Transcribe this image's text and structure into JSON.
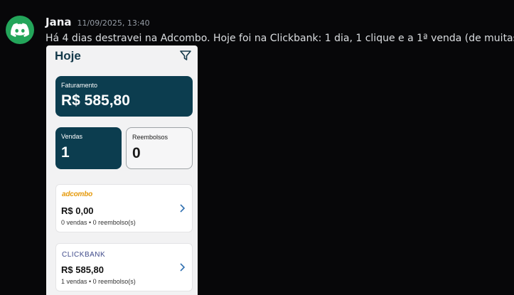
{
  "message": {
    "author": "Jana",
    "timestamp": "11/09/2025, 13:40",
    "text": "Há 4 dias destravei na Adcombo. Hoje foi na Clickbank: 1 dia, 1 clique e a 1ª venda (de muitas",
    "emoji": "🙌",
    "text_end": ").",
    "avatar_icon": "discord-logo-icon",
    "avatar_color": "#23a55a"
  },
  "app": {
    "title": "Hoje",
    "filter_icon": "filter-icon",
    "revenue": {
      "label": "Faturamento",
      "value": "R$ 585,80"
    },
    "sales": {
      "label": "Vendas",
      "value": "1"
    },
    "refunds": {
      "label": "Reembolsos",
      "value": "0"
    },
    "platforms": [
      {
        "logo": "adcombo",
        "amount": "R$ 0,00",
        "stats": "0 vendas • 0 reembolso(s)"
      },
      {
        "logo": "CLICKBANK",
        "amount": "R$ 585,80",
        "stats": "1 vendas • 0 reembolso(s)"
      }
    ],
    "accent_color": "#0c3d4f"
  }
}
